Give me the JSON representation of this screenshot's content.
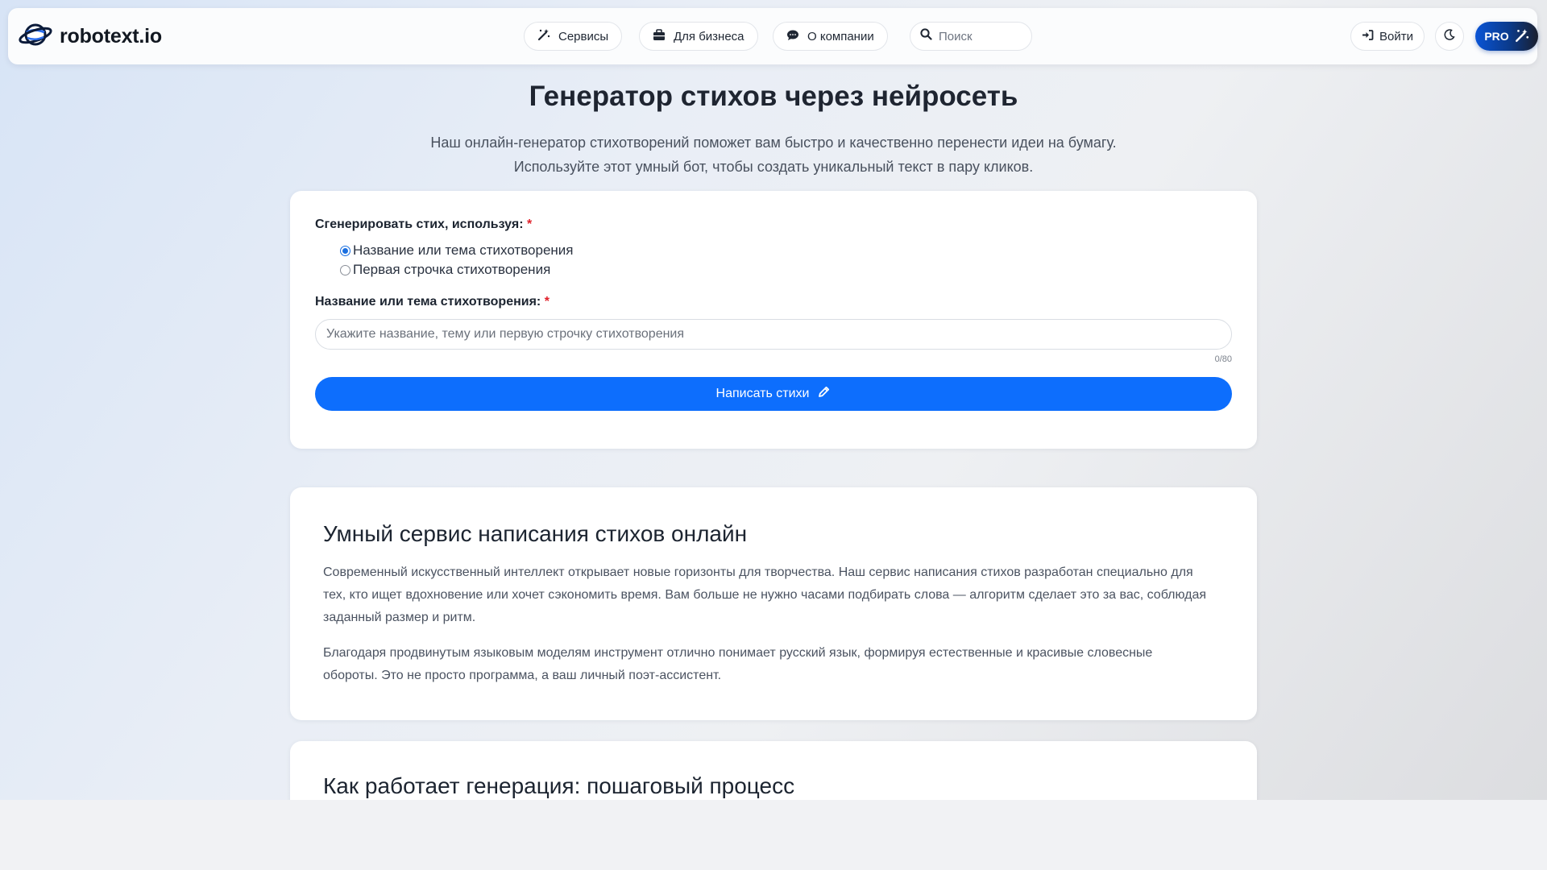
{
  "header": {
    "logo_text": "robotext.io",
    "nav": [
      {
        "label": "Сервисы",
        "icon": "magic-wand-icon"
      },
      {
        "label": "Для бизнеса",
        "icon": "briefcase-icon"
      },
      {
        "label": "О компании",
        "icon": "chat-bubble-icon"
      }
    ],
    "search_placeholder": "Поиск",
    "login_label": "Войти",
    "pro_label": "PRO",
    "accent": "#0d6efd"
  },
  "hero": {
    "title": "Генератор стихов через нейросеть",
    "subtitle_line1": "Наш онлайн-генератор стихотворений поможет вам быстро и качественно перенести идеи на бумагу.",
    "subtitle_line2": "Используйте этот умный бот, чтобы создать уникальный текст в пару кликов."
  },
  "form": {
    "mode_label": "Сгенерировать стих, используя:",
    "required_mark": "*",
    "options": [
      {
        "label": "Название или тема стихотворения",
        "selected": true
      },
      {
        "label": "Первая строчка стихотворения",
        "selected": false
      }
    ],
    "field_label": "Название или тема стихотворения:",
    "input_value": "",
    "input_placeholder": "Укажите название, тему или первую строчку стихотворения",
    "counter": "0/80",
    "submit_label": "Написать стихи"
  },
  "info": {
    "heading": "Умный сервис написания стихов онлайн",
    "paragraph1_line1": "Современный искусственный интеллект открывает новые горизонты для творчества. Наш сервис написания стихов разработан специально для",
    "paragraph1_line2": "тех, кто ищет вдохновение или хочет сэкономить время. Вам больше не нужно часами подбирать слова — алгоритм сделает это за вас, соблюдая",
    "paragraph1_line3": "заданный размер и ритм.",
    "paragraph2_line1": "Благодаря продвинутым языковым моделям инструмент отлично понимает русский язык, формируя естественные и красивые словесные",
    "paragraph2_line2": "обороты. Это не просто программа, а ваш личный поэт-ассистент."
  },
  "steps": {
    "heading": "Как работает генерация: пошаговый процесс"
  }
}
